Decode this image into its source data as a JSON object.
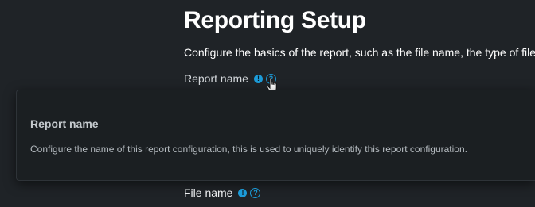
{
  "page": {
    "title": "Reporting Setup",
    "subtitle": "Configure the basics of the report, such as the file name, the type of file"
  },
  "fields": {
    "report_name": {
      "label": "Report name",
      "info_icon": "info-icon",
      "help_icon": "help-icon",
      "info_glyph": "!",
      "help_glyph": "?"
    },
    "file_name": {
      "label": "File name",
      "info_icon": "info-icon",
      "help_icon": "help-icon",
      "info_glyph": "!",
      "help_glyph": "?"
    }
  },
  "tooltip": {
    "title": "Report name",
    "body": "Configure the name of this report configuration, this is used to uniquely identify this report configuration."
  },
  "colors": {
    "background": "#1f2327",
    "tooltip_background": "#1b1f22",
    "accent": "#1c9bd8",
    "text": "#ffffff"
  }
}
